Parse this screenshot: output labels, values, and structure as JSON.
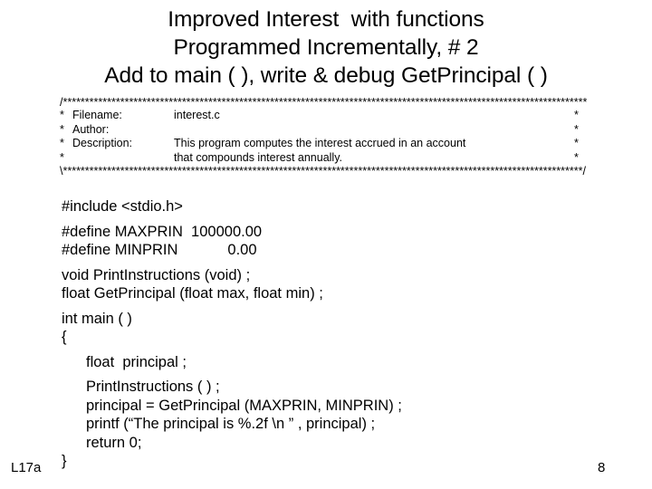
{
  "slide": {
    "title_lines": [
      "Improved Interest  with functions",
      "Programmed Incrementally, # 2",
      "Add to main ( ), write & debug GetPrincipal ( )"
    ],
    "comment_banner": {
      "top_rule": "/***********************************************************************************************************************\\",
      "bottom_rule": "\\**********************************************************************************************************************/",
      "star": "*",
      "rows": [
        {
          "label": "Filename:",
          "value": "interest.c"
        },
        {
          "label": "Author:",
          "value": ""
        },
        {
          "label": "Description:",
          "value": "This program computes the interest accrued in an account"
        },
        {
          "label": "",
          "value": "that compounds interest annually."
        }
      ]
    },
    "code_lines": [
      {
        "text": "#include <stdio.h>",
        "indent": false,
        "gap_before": false
      },
      {
        "text": "#define MAXPRIN  100000.00",
        "indent": false,
        "gap_before": true
      },
      {
        "text": "#define MINPRIN            0.00",
        "indent": false,
        "gap_before": false
      },
      {
        "text": "void PrintInstructions (void) ;",
        "indent": false,
        "gap_before": true
      },
      {
        "text": "float GetPrincipal (float max, float min) ;",
        "indent": false,
        "gap_before": false
      },
      {
        "text": "int main ( )",
        "indent": false,
        "gap_before": true
      },
      {
        "text": "{",
        "indent": false,
        "gap_before": false
      },
      {
        "text": "float  principal ;",
        "indent": true,
        "gap_before": true
      },
      {
        "text": "PrintInstructions ( ) ;",
        "indent": true,
        "gap_before": true
      },
      {
        "text": "principal = GetPrincipal (MAXPRIN, MINPRIN) ;",
        "indent": true,
        "gap_before": false
      },
      {
        "text": "printf (“The principal is %.2f \\n ” , principal) ;",
        "indent": true,
        "gap_before": false
      },
      {
        "text": "return 0;",
        "indent": true,
        "gap_before": false
      },
      {
        "text": "}",
        "indent": false,
        "gap_before": false
      }
    ],
    "footer": {
      "label": "L17a",
      "page_number": "8"
    },
    "colors": {
      "background": "#ffffff",
      "text": "#000000"
    }
  }
}
